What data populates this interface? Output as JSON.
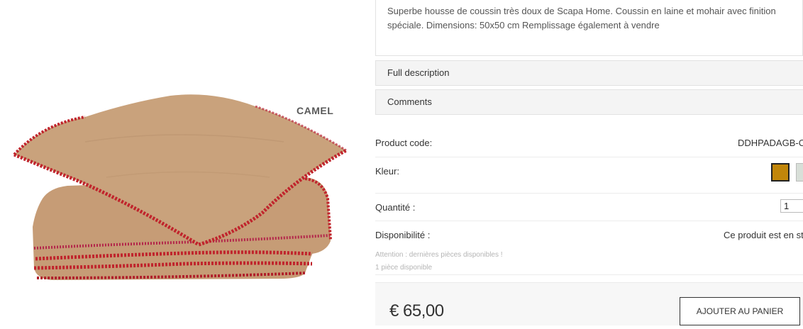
{
  "product": {
    "color_label_overlay": "CAMEL",
    "description": "Superbe housse de coussin très doux de Scapa Home. Coussin en laine et mohair avec finition spéciale. Dimensions: 50x50 cm Remplissage également à vendre",
    "accordion": {
      "full_description": "Full description",
      "comments": "Comments"
    },
    "fields": {
      "product_code_label": "Product code:",
      "product_code_value": "DDHPADAGB-C",
      "color_label": "Kleur:",
      "quantity_label": "Quantité :",
      "quantity_value": "1",
      "availability_label": "Disponibilité :",
      "availability_value": "Ce produit est en stock"
    },
    "notes": {
      "attention": "Attention : dernières pièces disponibles !",
      "count": "1 pièce disponible"
    },
    "price": "€ 65,00",
    "add_to_cart": "AJOUTER AU PANIER",
    "swatch_colors": [
      "#c1860a",
      "#d8dfd8"
    ],
    "colors": {
      "blanket": "#c9a27c",
      "stitch": "#c0242c"
    }
  }
}
